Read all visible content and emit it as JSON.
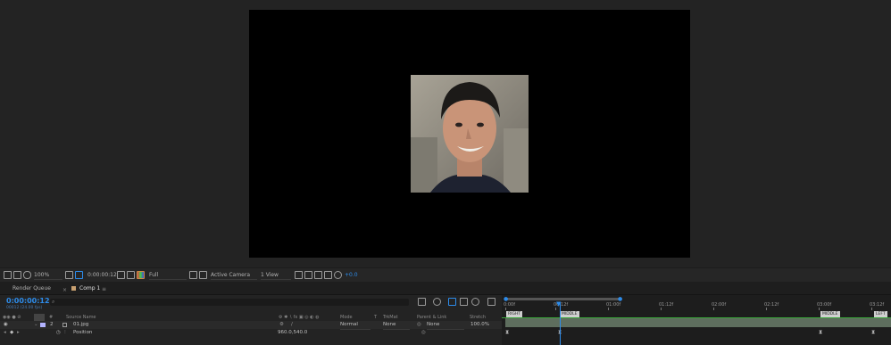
{
  "viewer": {
    "photo_icon": "portrait-photo"
  },
  "viewer_toolbar": {
    "zoom": "100%",
    "timecode": "0:00:00:12",
    "resolution": "Full",
    "camera": "Active Camera",
    "view_layout": "1 View",
    "exposure": "+0.0"
  },
  "tabs": {
    "render_queue": "Render Queue",
    "comp": "Comp 1"
  },
  "timeline": {
    "current_time": "0:00:00:12",
    "fps_info": "00012 (24.00 fps)",
    "search_placeholder": "",
    "headers": {
      "num": "#",
      "source_name": "Source Name",
      "mode": "Mode",
      "t": "T",
      "trkmat": "TrkMat",
      "parent": "Parent & Link",
      "stretch": "Stretch"
    },
    "layer": {
      "index": "2",
      "name": "01.jpg",
      "mode": "Normal",
      "trkmat": "None",
      "parent": "None",
      "stretch": "100.0%"
    },
    "property": {
      "name": "Position",
      "value": "960.0,540.0"
    },
    "ruler_ticks": [
      "0:00f",
      "00:12f",
      "01:00f",
      "01:12f",
      "02:00f",
      "02:12f",
      "03:00f",
      "03:12f"
    ],
    "markers": [
      "RIGHT",
      "MIDDLE",
      "MIDDLE",
      "LEFT"
    ]
  },
  "colors": {
    "accent": "#2d8ceb",
    "layer_bar": "#5e6e5e",
    "label": "#b3b3ff"
  }
}
